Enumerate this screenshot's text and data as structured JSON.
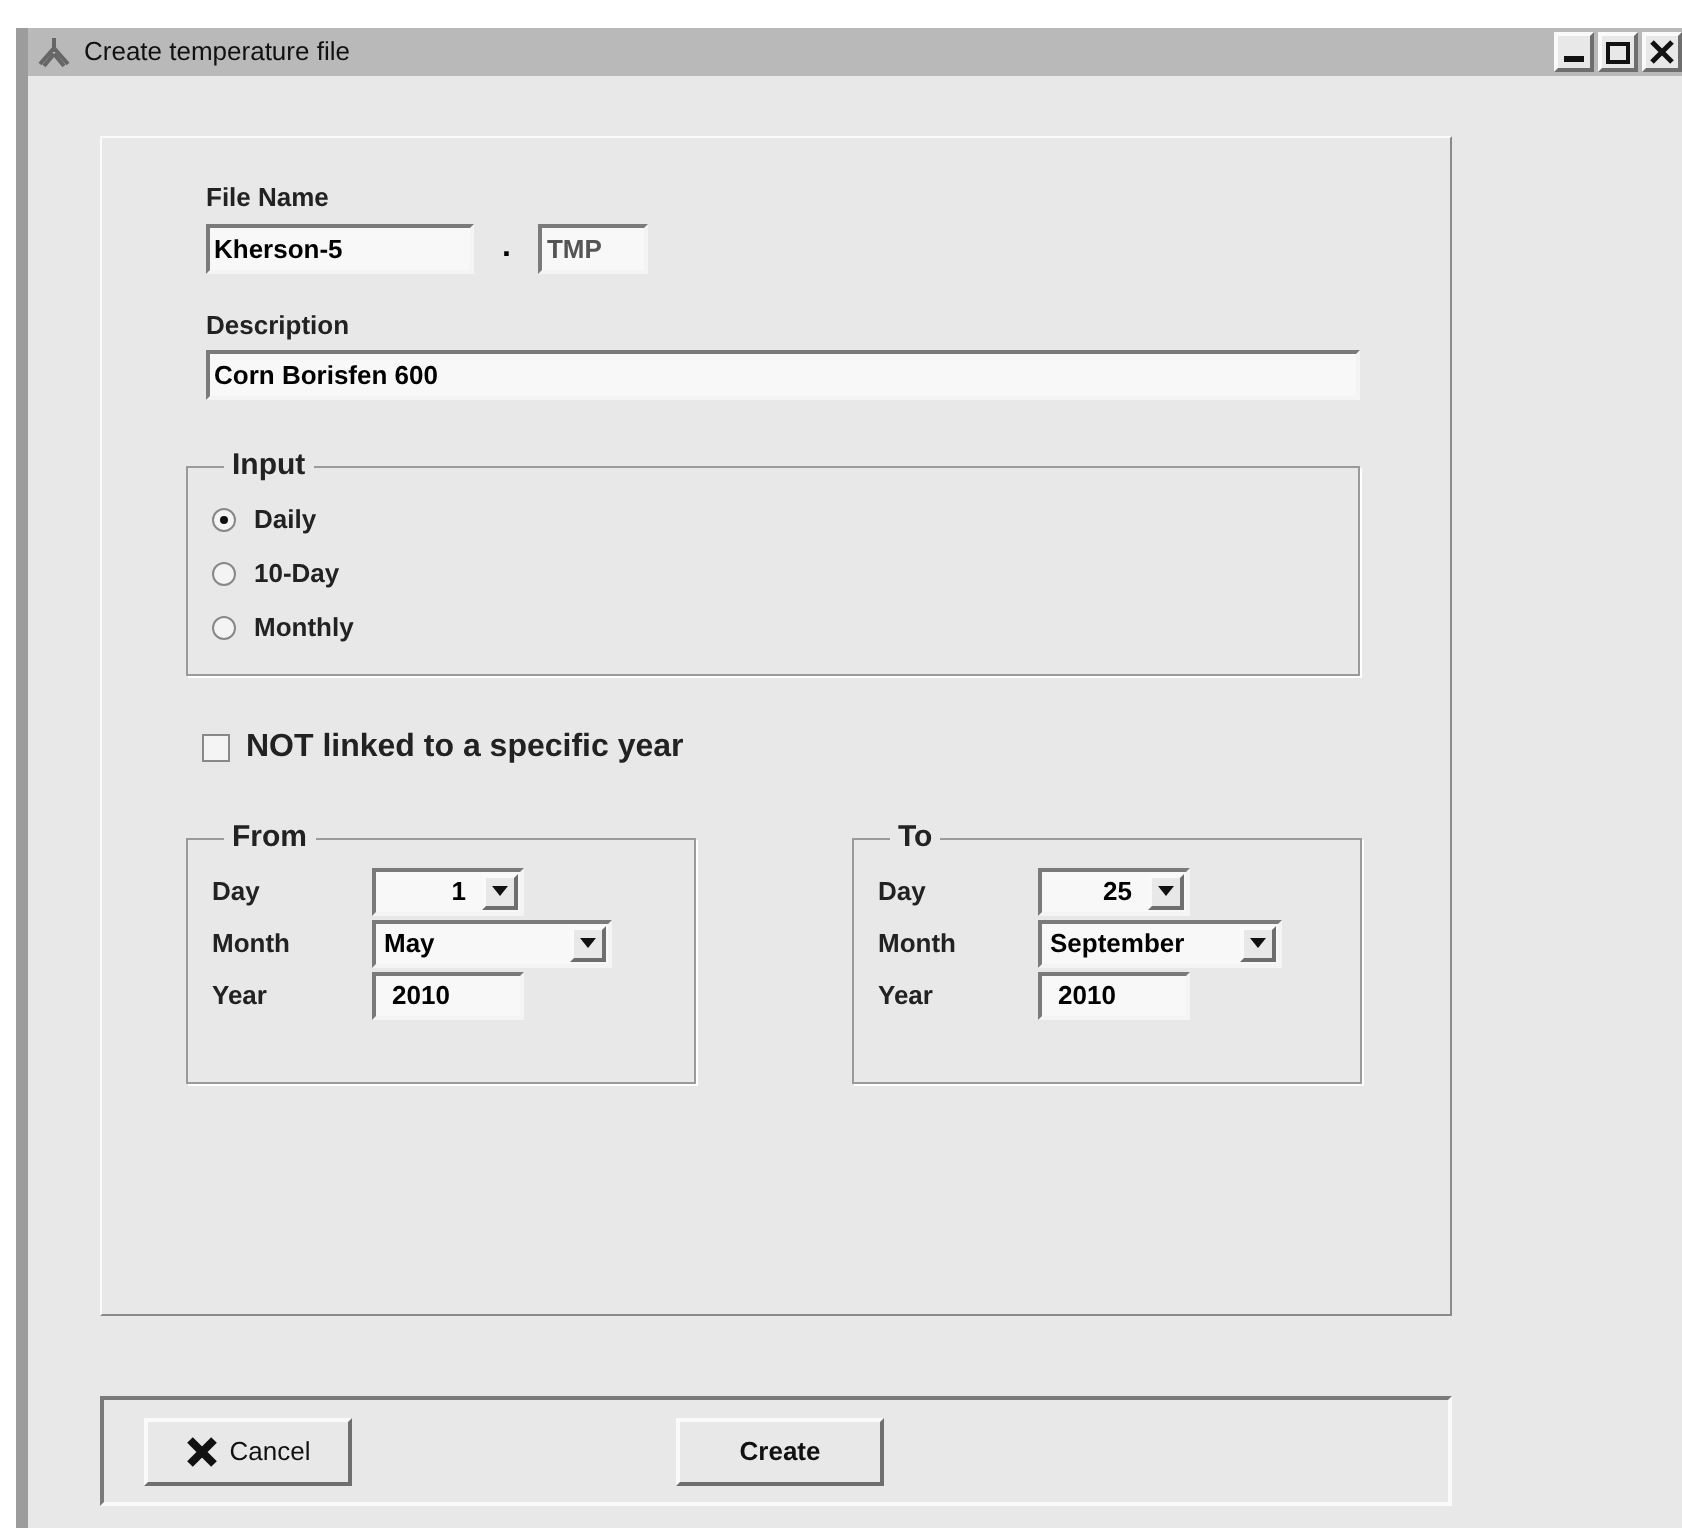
{
  "window": {
    "title": "Create temperature file"
  },
  "file_name": {
    "label": "File Name",
    "value": "Kherson-5",
    "separator": ".",
    "extension": "TMP"
  },
  "description": {
    "label": "Description",
    "value": "Corn Borisfen 600"
  },
  "input": {
    "title": "Input",
    "options": [
      {
        "label": "Daily",
        "selected": true
      },
      {
        "label": "10-Day",
        "selected": false
      },
      {
        "label": "Monthly",
        "selected": false
      }
    ]
  },
  "not_linked": {
    "label": "NOT linked to a specific year",
    "checked": false
  },
  "ranges": [
    {
      "title": "From",
      "day_label": "Day",
      "day": "1",
      "month_label": "Month",
      "month": "May",
      "year_label": "Year",
      "year": "2010"
    },
    {
      "title": "To",
      "day_label": "Day",
      "day": "25",
      "month_label": "Month",
      "month": "September",
      "year_label": "Year",
      "year": "2010"
    }
  ],
  "buttons": [
    {
      "label": "Cancel",
      "kind": "cancel"
    },
    {
      "label": "Create",
      "kind": "plain"
    }
  ]
}
